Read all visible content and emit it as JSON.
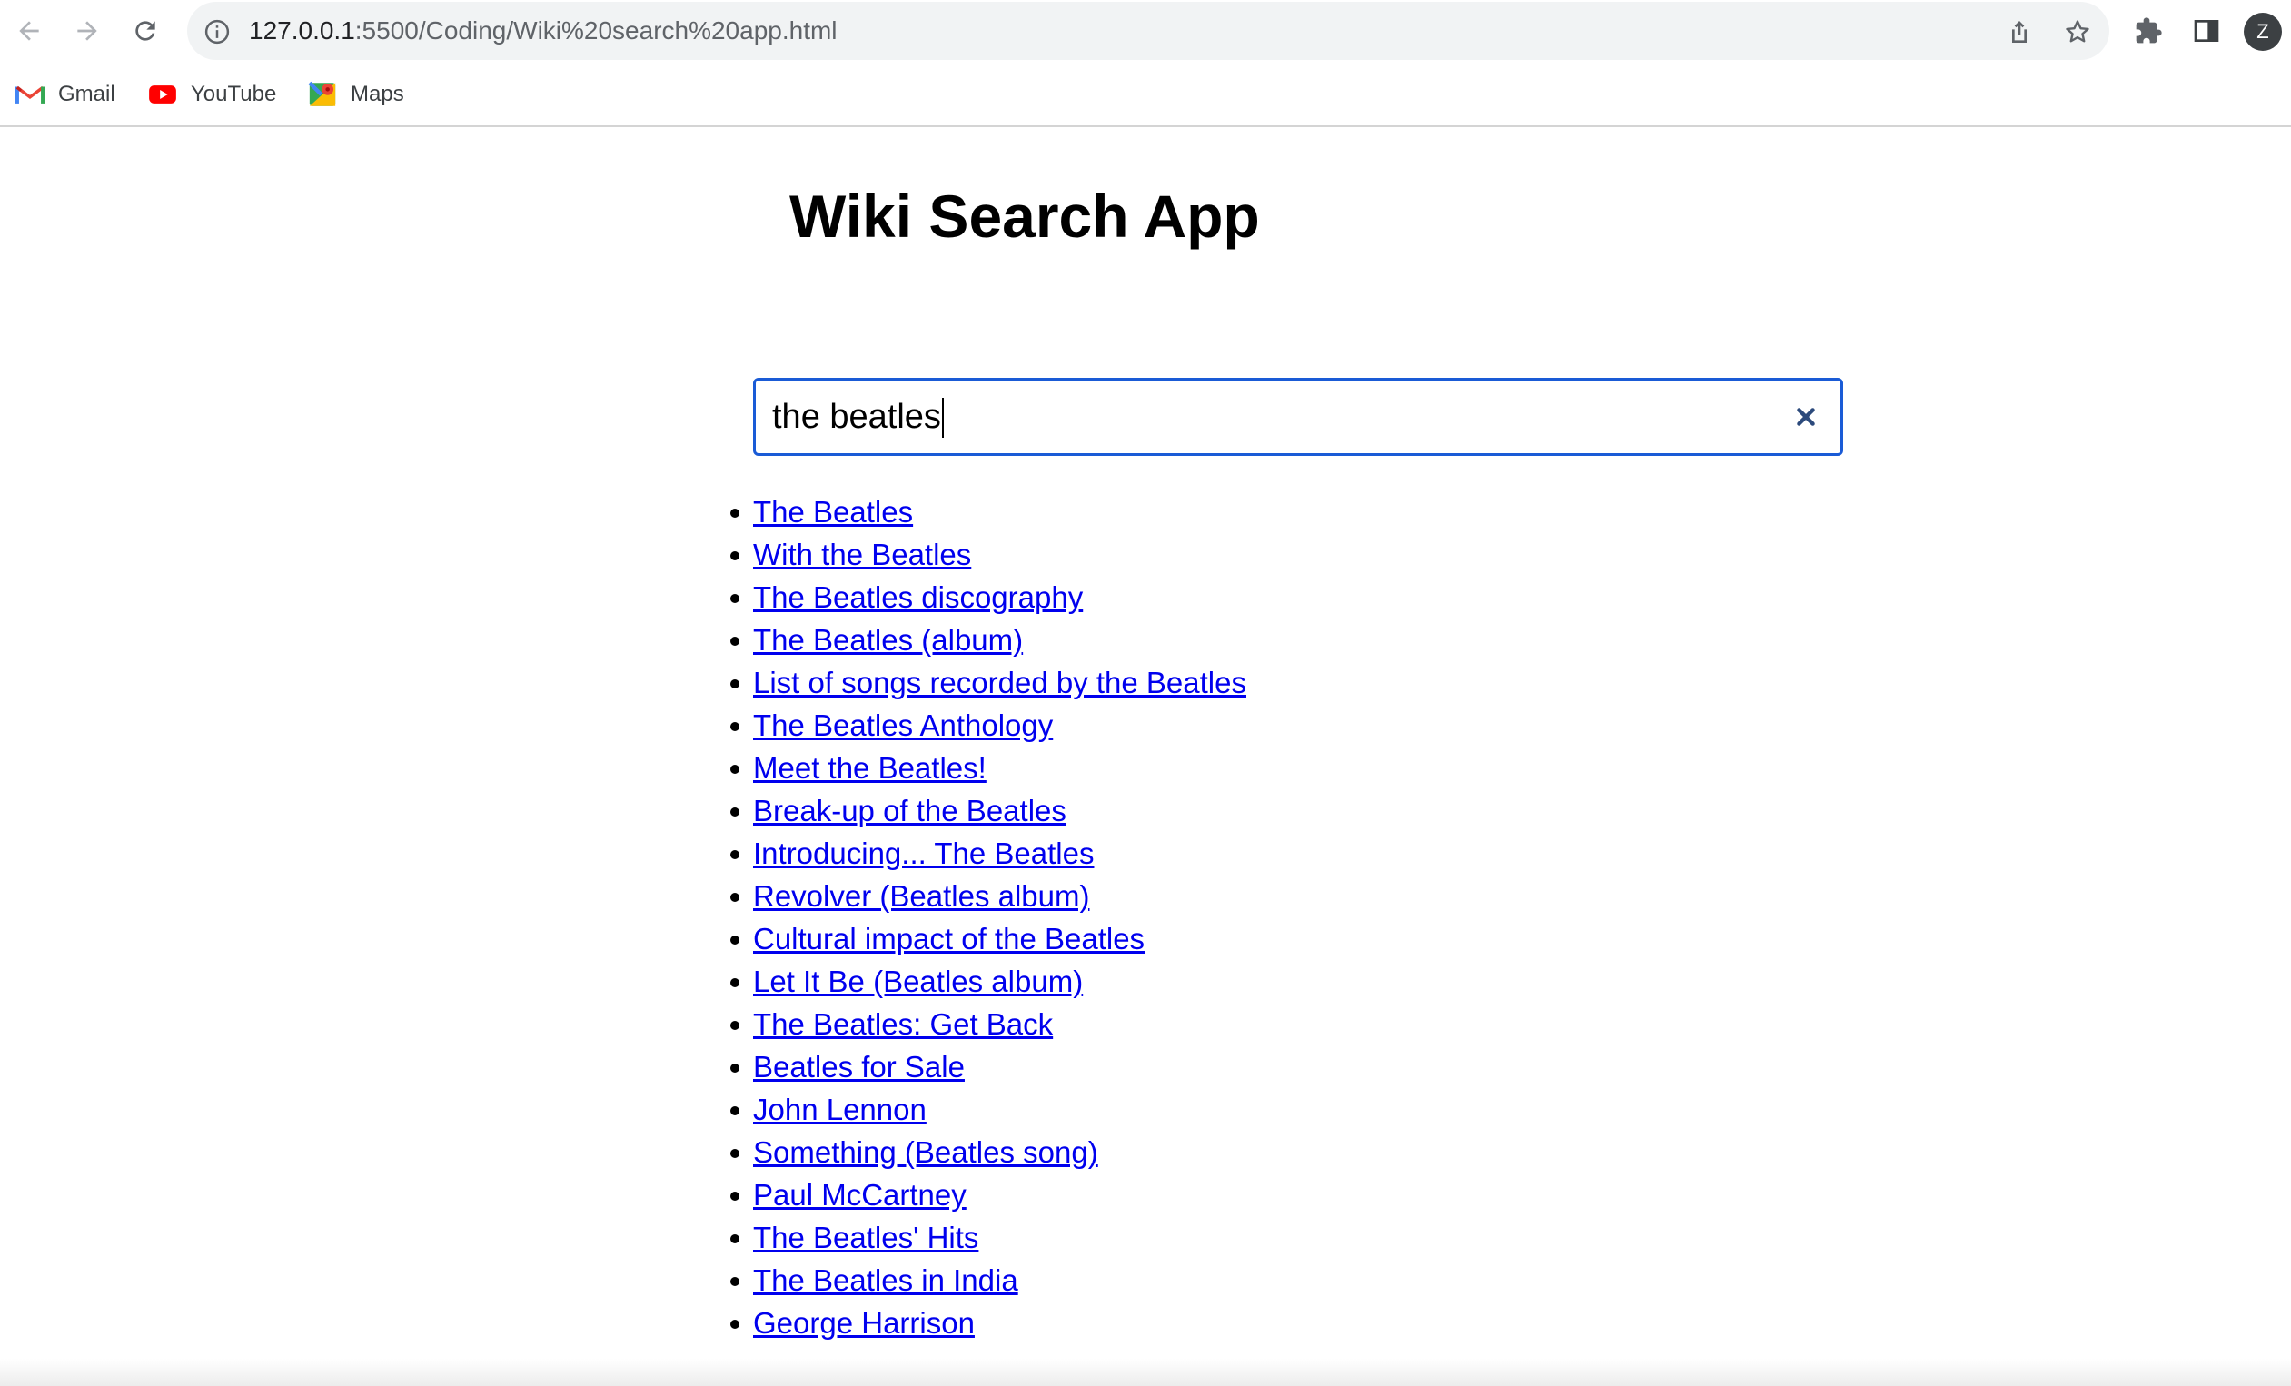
{
  "browser": {
    "url_host": "127.0.0.1",
    "url_path": ":5500/Coding/Wiki%20search%20app.html",
    "profile_initial": "Z",
    "icons": [
      "back-arrow-icon",
      "forward-arrow-icon",
      "reload-icon",
      "site-info-icon",
      "share-icon",
      "star-icon",
      "extensions-puzzle-icon",
      "side-panel-icon"
    ]
  },
  "bookmarks": [
    {
      "label": "Gmail",
      "icon": "gmail-icon"
    },
    {
      "label": "YouTube",
      "icon": "youtube-icon"
    },
    {
      "label": "Maps",
      "icon": "maps-icon"
    }
  ],
  "app": {
    "title": "Wiki Search App",
    "search": {
      "value": "the beatles",
      "clear_icon": "close-x-icon"
    },
    "results": [
      "The Beatles",
      "With the Beatles",
      "The Beatles discography",
      "The Beatles (album)",
      "List of songs recorded by the Beatles",
      "The Beatles Anthology",
      "Meet the Beatles!",
      "Break-up of the Beatles",
      "Introducing... The Beatles",
      "Revolver (Beatles album)",
      "Cultural impact of the Beatles",
      "Let It Be (Beatles album)",
      "The Beatles: Get Back",
      "Beatles for Sale",
      "John Lennon",
      "Something (Beatles song)",
      "Paul McCartney",
      "The Beatles' Hits",
      "The Beatles in India",
      "George Harrison"
    ]
  },
  "colors": {
    "link": "#0000ee",
    "search_border": "#1a5bd6",
    "clear_icon": "#2c4a7c",
    "omnibox_bg": "#f1f3f4"
  }
}
